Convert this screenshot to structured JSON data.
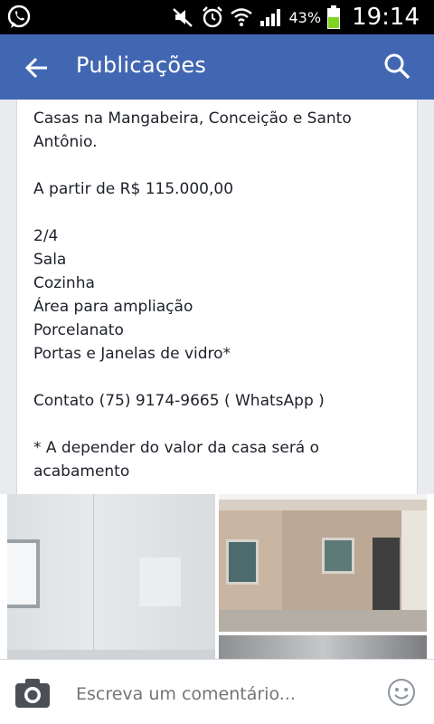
{
  "status_bar": {
    "battery_percent": "43%",
    "time": "19:14",
    "icons": [
      "whatsapp-icon",
      "mute-icon",
      "alarm-icon",
      "wifi-icon",
      "signal-icon",
      "battery-icon"
    ]
  },
  "app_bar": {
    "title": "Publicações",
    "back_icon": "arrow-left-icon",
    "search_icon": "search-icon"
  },
  "post": {
    "lines": [
      "Casas na Mangabeira, Conceição e Santo Antônio.",
      "A partir de R$ 115.000,00",
      "2/4",
      "Sala",
      "Cozinha",
      "Área para ampliação",
      "Porcelanato",
      "Portas e Janelas de vidro*",
      "Contato (75) 9174-9665 ( WhatsApp )",
      "* A depender do valor da casa será o acabamento"
    ]
  },
  "comment_bar": {
    "placeholder": "Escreva um comentário...",
    "camera_icon": "camera-icon",
    "emoji_icon": "emoji-icon"
  },
  "colors": {
    "app_bar": "#4267b2",
    "status_bar": "#000000",
    "battery_fill": "#7ed321"
  }
}
